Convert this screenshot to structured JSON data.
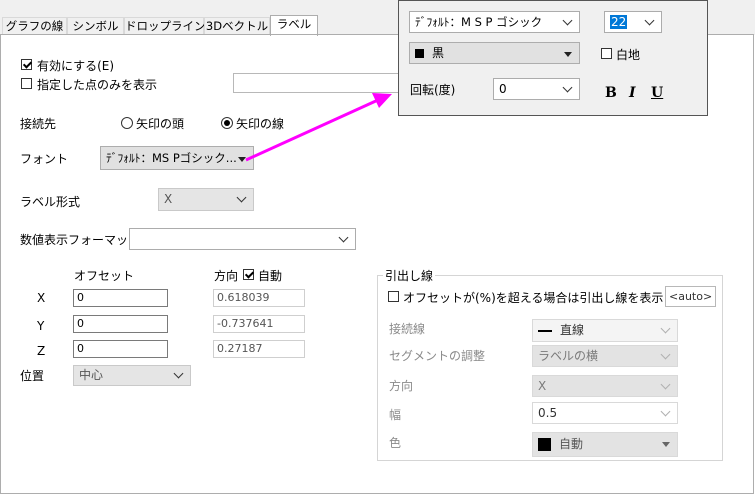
{
  "tabs": [
    "グラフの線",
    "シンボル",
    "ドロップライン",
    "3Dベクトル",
    "ラベル"
  ],
  "enable_label": "有効にする(E)",
  "show_specified_points": "指定した点のみを表示",
  "connect_to": {
    "label": "接続先",
    "option_head": "矢印の頭",
    "option_line": "矢印の線"
  },
  "font": {
    "label": "フォント",
    "value": "ﾃﾞﾌｫﾙﾄ：MS Pゴシック..."
  },
  "label_format": {
    "label": "ラベル形式",
    "value": "X"
  },
  "number_format": {
    "label": "数値表示フォーマット",
    "value": ""
  },
  "offset": {
    "header": "オフセット",
    "direction_header": "方向",
    "auto_label": "自動",
    "rows": [
      {
        "axis": "X",
        "offset": "0",
        "direction": "0.618039"
      },
      {
        "axis": "Y",
        "offset": "0",
        "direction": "-0.737641"
      },
      {
        "axis": "Z",
        "offset": "0",
        "direction": "0.27187"
      }
    ]
  },
  "position": {
    "label": "位置",
    "value": "中心"
  },
  "leader": {
    "title": "引出し線",
    "threshold_label": "オフセットが(%)を超える場合は引出し線を表示",
    "threshold_value": "<auto>",
    "connector_label": "接続線",
    "connector_value": "直線",
    "segment_label": "セグメントの調整",
    "segment_value": "ラベルの横",
    "direction_label": "方向",
    "direction_value": "X",
    "width_label": "幅",
    "width_value": "0.5",
    "color_label": "色",
    "color_value": "自動"
  },
  "popup": {
    "font_value": "ﾃﾞﾌｫﾙﾄ：M S  P ゴシック",
    "size_value": "22",
    "color_value": "黒",
    "white_bg_label": "白地",
    "rotation_label": "回転(度)",
    "rotation_value": "0",
    "bold": "B",
    "italic": "I",
    "underline": "U"
  },
  "colors": {
    "arrow": "#ff00ff",
    "selection": "#0078d7"
  }
}
